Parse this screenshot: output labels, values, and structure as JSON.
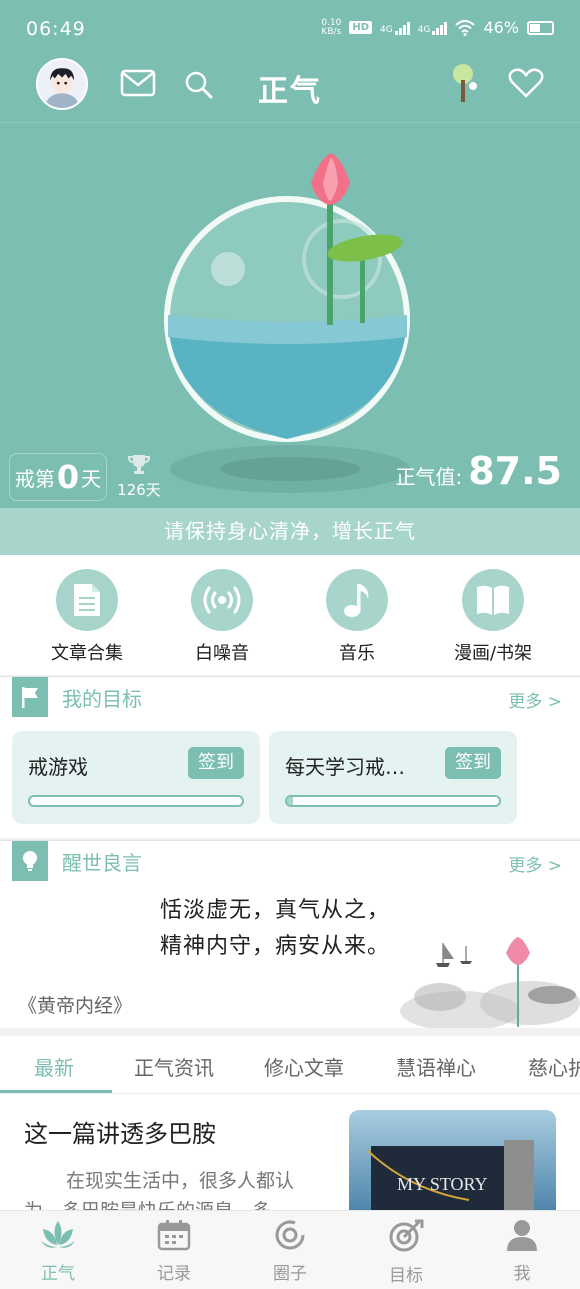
{
  "status_bar": {
    "time": "06:49",
    "speed_value": "0.10",
    "speed_unit": "KB/s",
    "hd_label": "HD",
    "net1": "4G",
    "net2": "4G",
    "battery": "46%"
  },
  "header": {
    "title": "正气"
  },
  "hero": {
    "day_prefix": "戒第",
    "day_count": "0",
    "day_suffix": "天",
    "record_days": "126天",
    "score_label": "正气值:",
    "score_value": "87.5"
  },
  "slogan": "请保持身心清净，增长正气",
  "shortcuts": [
    {
      "label": "文章合集",
      "icon": "document-icon"
    },
    {
      "label": "白噪音",
      "icon": "broadcast-icon"
    },
    {
      "label": "音乐",
      "icon": "music-note-icon"
    },
    {
      "label": "漫画/书架",
      "icon": "open-book-icon"
    }
  ],
  "goals": {
    "title": "我的目标",
    "more": "更多 >",
    "items": [
      {
        "name": "戒游戏",
        "button": "签到",
        "progress": 0.0
      },
      {
        "name": "每天学习戒…",
        "button": "签到",
        "progress": 0.03
      }
    ]
  },
  "quote": {
    "title": "醒世良言",
    "more": "更多 >",
    "line1": "恬淡虚无，真气从之，",
    "line2": "精神内守，病安从来。",
    "source": "《黄帝内经》"
  },
  "tabs": [
    "最新",
    "正气资讯",
    "修心文章",
    "慧语禅心",
    "慈心护"
  ],
  "article": {
    "title": "这一篇讲透多巴胺",
    "excerpt": "在现实生活中，很多人都认为，多巴胺是快乐的源泉，多…",
    "image_text": "MY STORY"
  },
  "bottom_nav": [
    {
      "label": "正气",
      "icon": "lotus-icon",
      "active": true
    },
    {
      "label": "记录",
      "icon": "calendar-icon",
      "active": false
    },
    {
      "label": "圈子",
      "icon": "circle-icon",
      "active": false
    },
    {
      "label": "目标",
      "icon": "target-icon",
      "active": false
    },
    {
      "label": "我",
      "icon": "person-icon",
      "active": false
    }
  ],
  "colors": {
    "primary": "#7cbfb2",
    "light": "#a7d5cc",
    "card": "#e4f2f1"
  }
}
